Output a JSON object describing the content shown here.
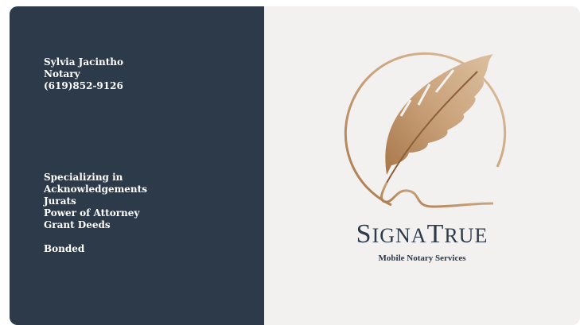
{
  "contact": {
    "name": "Sylvia Jacintho",
    "title": "Notary",
    "phone": "(619)852-9126"
  },
  "services": {
    "heading": "Specializing in",
    "items": [
      "Acknowledgements",
      "Jurats",
      "Power of Attorney",
      "Grant Deeds"
    ],
    "bonded": "Bonded"
  },
  "brand": {
    "name_part1_initial": "S",
    "name_part1_rest": "IGNA",
    "name_part2_initial": "T",
    "name_part2_rest": "RUE",
    "tagline": "Mobile Notary Services",
    "logo_icon": "quill-feather-icon"
  },
  "colors": {
    "panel": "#2d3a4a",
    "background": "#f2f1ef",
    "gold": "#c49a6c"
  }
}
